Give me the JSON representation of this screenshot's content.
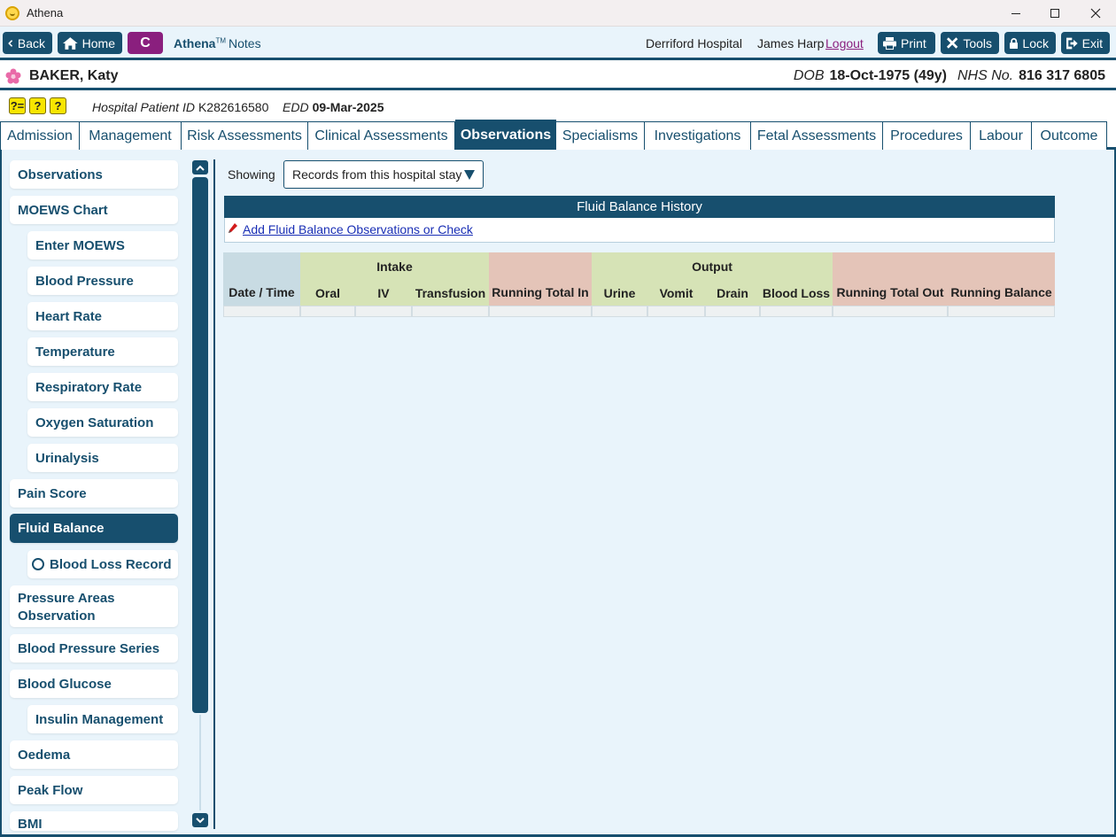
{
  "window": {
    "title": "Athena",
    "icon": "athena-smiley-icon"
  },
  "toolbar": {
    "back_label": "Back",
    "home_label": "Home",
    "c_label": "C",
    "brand_name": "Athena",
    "brand_tm": "TM",
    "brand_suffix": "Notes",
    "hospital": "Derriford Hospital",
    "user": "James Harp",
    "logout_label": "Logout",
    "print_label": "Print",
    "tools_label": "Tools",
    "lock_label": "Lock",
    "exit_label": "Exit"
  },
  "patient": {
    "name": "BAKER, Katy",
    "dob_label": "DOB",
    "dob": "18-Oct-1975 (49y)",
    "nhs_label": "NHS No.",
    "nhs": "816 317 6805"
  },
  "info": {
    "hpid_label": "Hospital Patient ID",
    "hpid": "K282616580",
    "edd_label": "EDD",
    "edd": "09-Mar-2025",
    "badges": [
      "?=",
      "?",
      "?"
    ]
  },
  "tabs": [
    "Admission",
    "Management",
    "Risk Assessments",
    "Clinical Assessments",
    "Observations",
    "Specialisms",
    "Investigations",
    "Fetal Assessments",
    "Procedures",
    "Labour",
    "Outcome"
  ],
  "active_tab": "Observations",
  "sidebar": {
    "items": [
      {
        "label": "Observations"
      },
      {
        "label": "MOEWS Chart"
      },
      {
        "label": "Enter MOEWS"
      },
      {
        "label": "Blood Pressure"
      },
      {
        "label": "Heart Rate"
      },
      {
        "label": "Temperature"
      },
      {
        "label": "Respiratory Rate"
      },
      {
        "label": "Oxygen Saturation"
      },
      {
        "label": "Urinalysis"
      },
      {
        "label": "Pain Score"
      },
      {
        "label": "Fluid Balance"
      },
      {
        "label": "Blood Loss Record"
      },
      {
        "label": "Pressure Areas Observation"
      },
      {
        "label": "Blood Pressure Series"
      },
      {
        "label": "Blood Glucose"
      },
      {
        "label": "Insulin Management"
      },
      {
        "label": "Oedema"
      },
      {
        "label": "Peak Flow"
      },
      {
        "label": "BMI"
      }
    ],
    "active": "Fluid Balance"
  },
  "filter": {
    "label": "Showing",
    "selected": "Records from this hospital stay"
  },
  "panel": {
    "title": "Fluid Balance History",
    "add_link": "Add Fluid Balance Observations or Check"
  },
  "table": {
    "group_intake": "Intake",
    "group_output": "Output",
    "columns": [
      "Date / Time",
      "Oral",
      "IV",
      "Transfusion",
      "Running Total In",
      "Urine",
      "Vomit",
      "Drain",
      "Blood Loss",
      "Running Total Out",
      "Running Balance"
    ],
    "rows": []
  },
  "colors": {
    "primary": "#174f6e",
    "accent": "#8a1f7e",
    "background": "#e9f4fb",
    "intake": "#d6e3b6",
    "running": "#e4c4b8",
    "datetime": "#c8dbe3"
  }
}
